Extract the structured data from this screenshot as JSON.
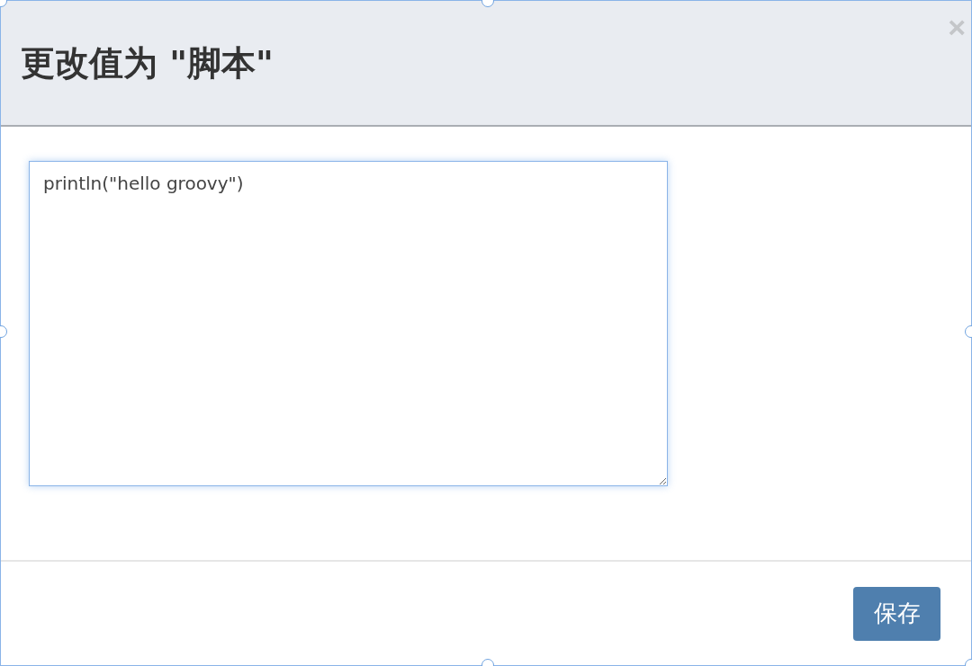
{
  "dialog": {
    "title": "更改值为 \"脚本\"",
    "close": "×",
    "script_field": {
      "value": "println(\"hello groovy\")"
    },
    "buttons": [
      {
        "label": "保存",
        "kind": "primary"
      }
    ]
  }
}
